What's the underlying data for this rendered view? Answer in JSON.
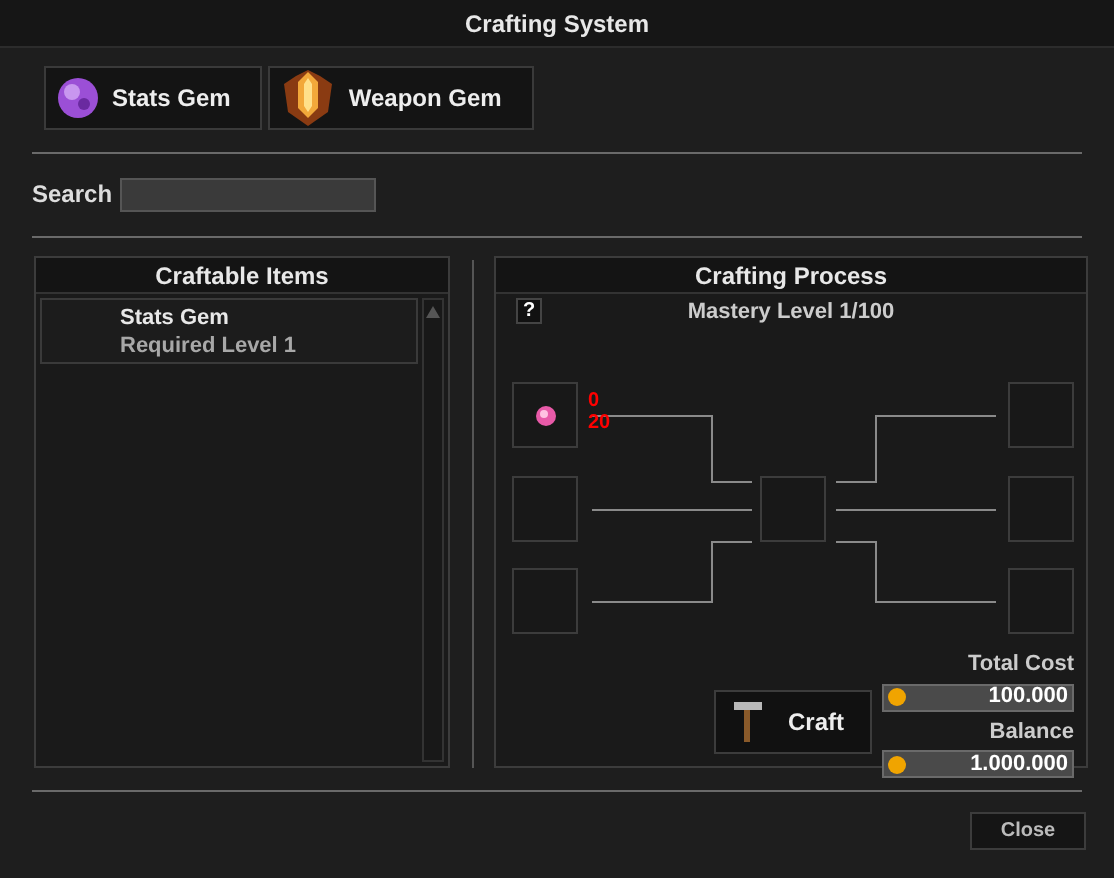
{
  "window": {
    "title": "Crafting System"
  },
  "tabs": [
    {
      "label": "Stats Gem",
      "kind": "orb"
    },
    {
      "label": "Weapon Gem",
      "kind": "crest"
    }
  ],
  "search": {
    "label": "Search"
  },
  "craftable_items": {
    "title": "Craftable Items",
    "items": [
      {
        "name": "Stats Gem",
        "requirement": "Required Level 1"
      }
    ]
  },
  "crafting_process": {
    "title": "Crafting Process",
    "help": "?",
    "mastery": "Mastery Level 1/100",
    "materials": [
      {
        "filled": true,
        "owned": "0",
        "required": "20"
      },
      {
        "filled": false
      },
      {
        "filled": false
      }
    ],
    "craft_button": "Craft",
    "total_cost_label": "Total Cost",
    "total_cost": "100.000",
    "balance_label": "Balance",
    "balance": "1.000.000"
  },
  "buttons": [
    "Close"
  ]
}
